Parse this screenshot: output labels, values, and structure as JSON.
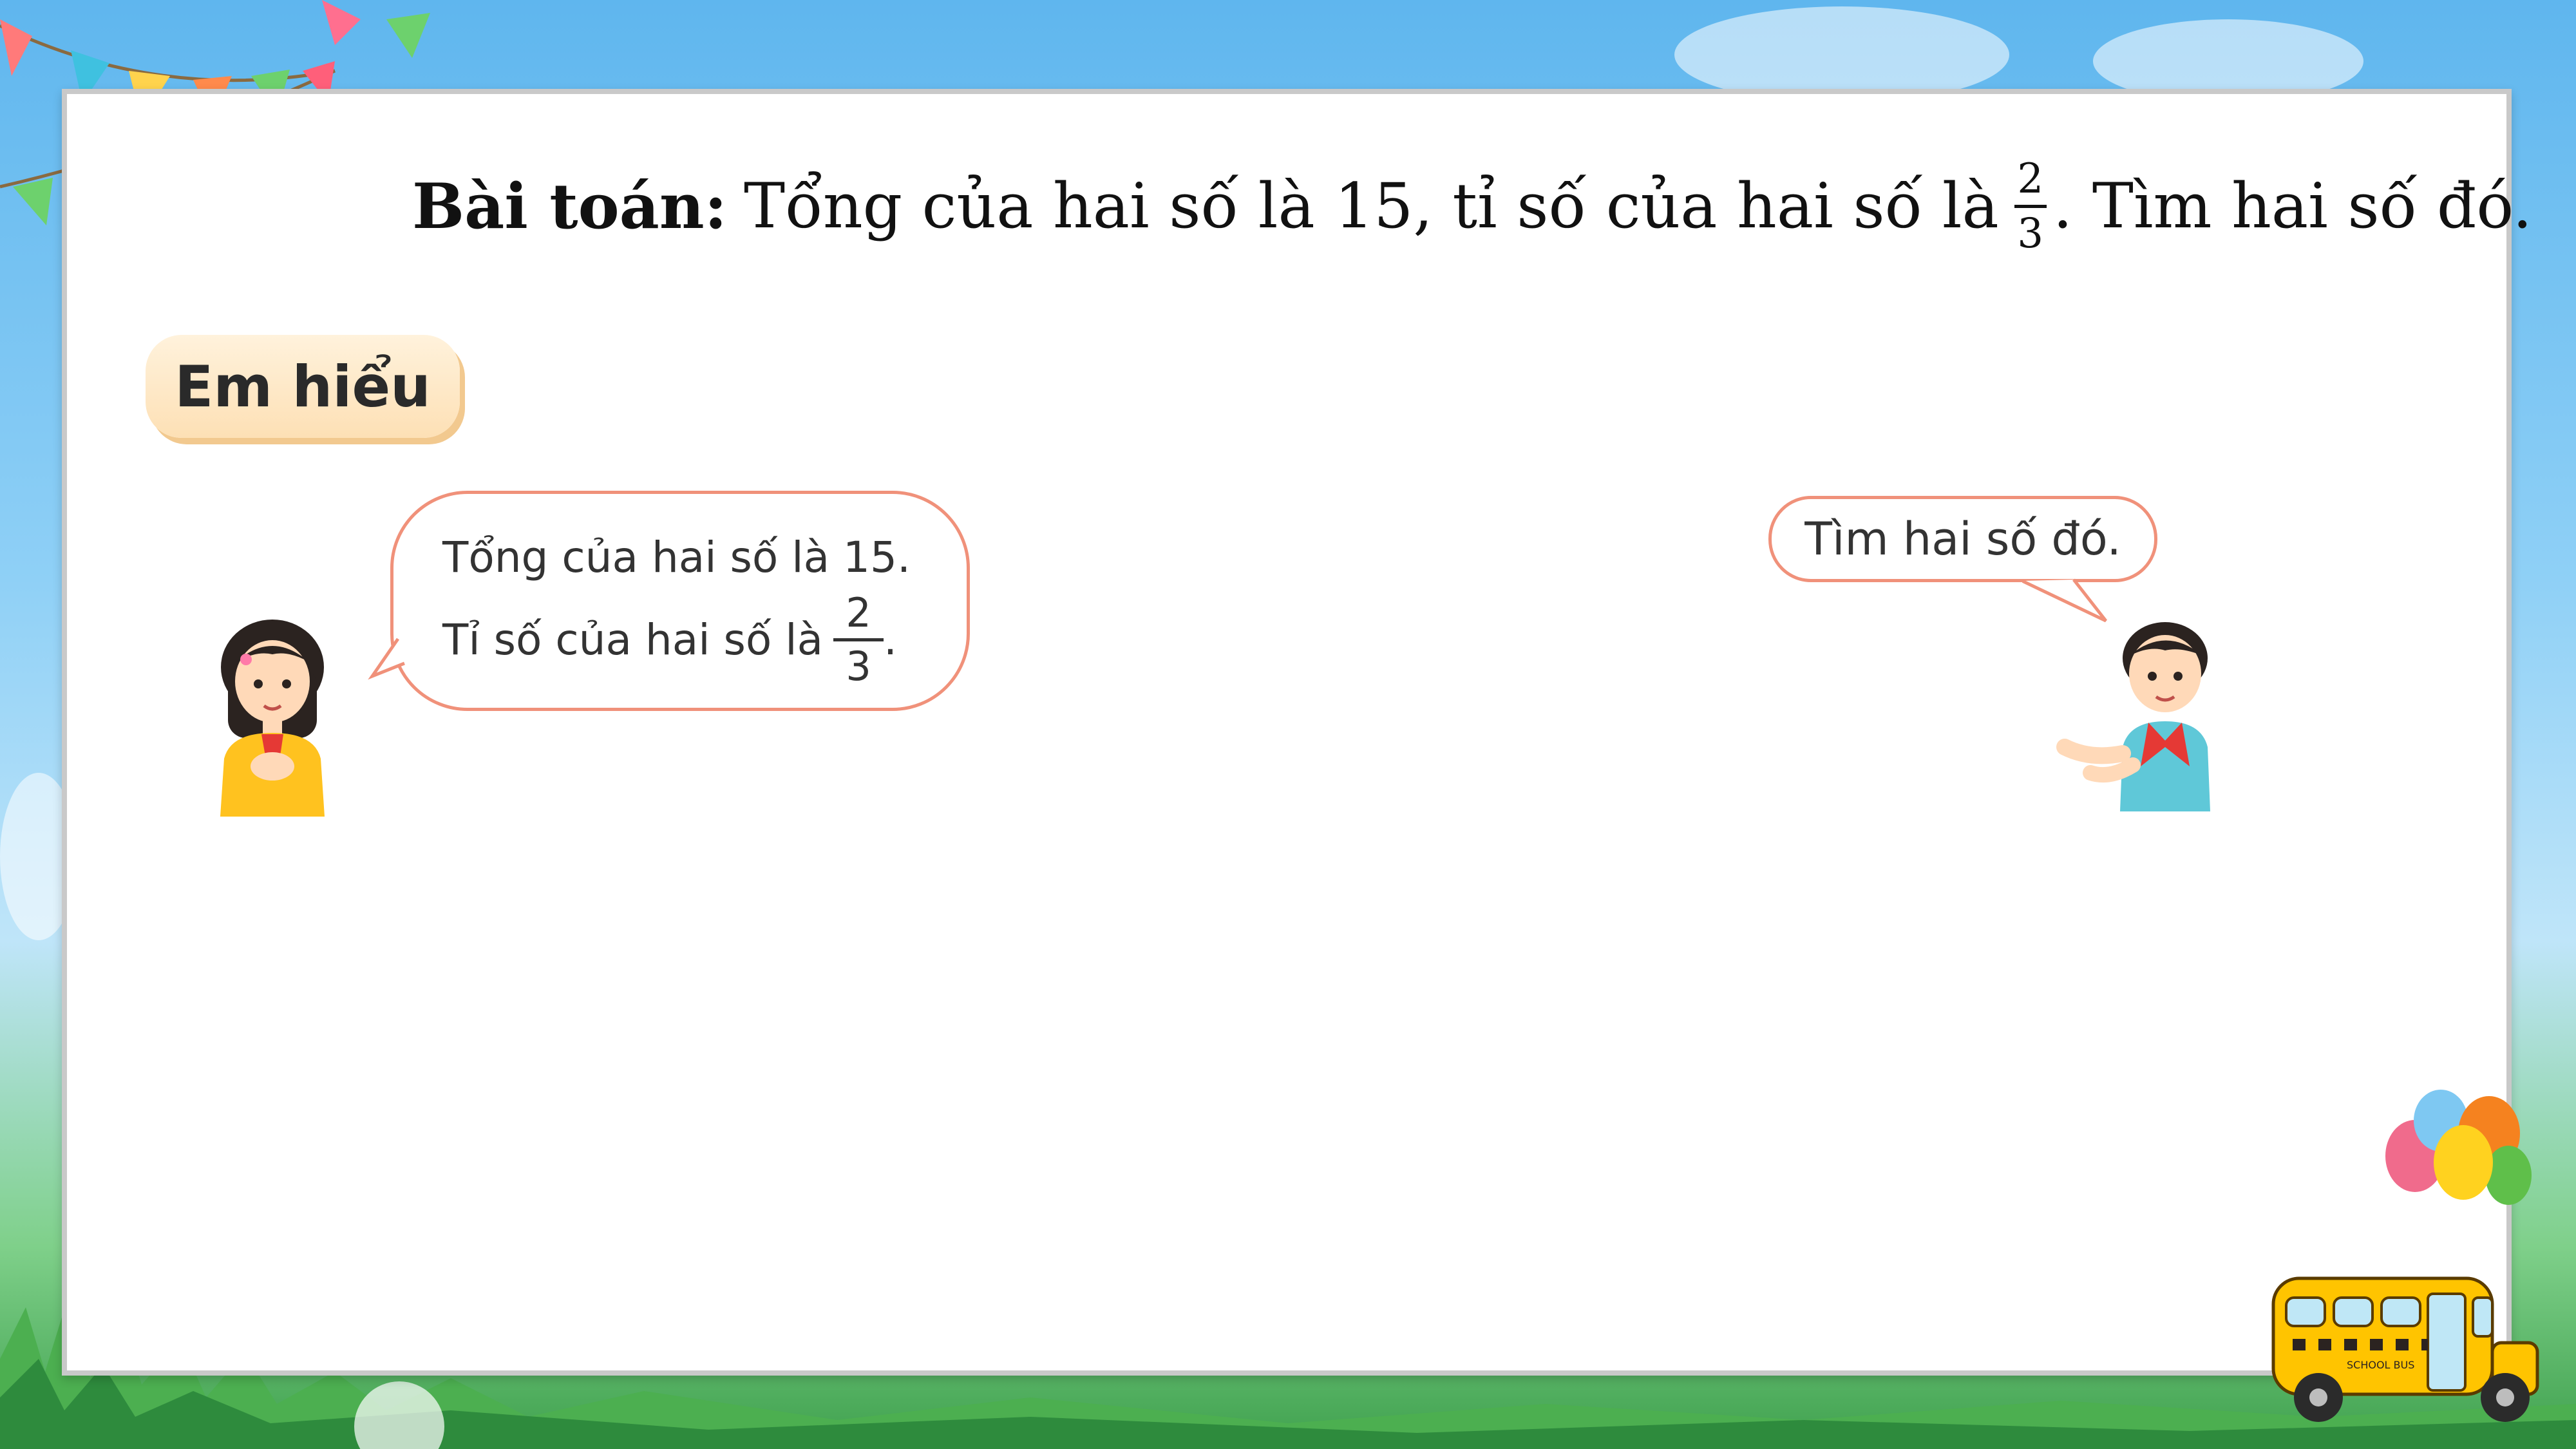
{
  "problem": {
    "label": "Bài toán:",
    "text_before": "Tổng của hai số là 15, tỉ số của hai số là",
    "fraction": {
      "numerator": "2",
      "denominator": "3"
    },
    "text_after": ". Tìm hai số đó."
  },
  "section_label": "Em hiểu",
  "girl_bubble": {
    "line1": "Tổng của hai số là 15.",
    "line2": "Tỉ số của hai số là",
    "fraction": {
      "numerator": "2",
      "denominator": "3"
    },
    "line2_end": "."
  },
  "boy_bubble": {
    "text": "Tìm hai số đó."
  },
  "decor": {
    "bus_label": "SCHOOL BUS"
  }
}
